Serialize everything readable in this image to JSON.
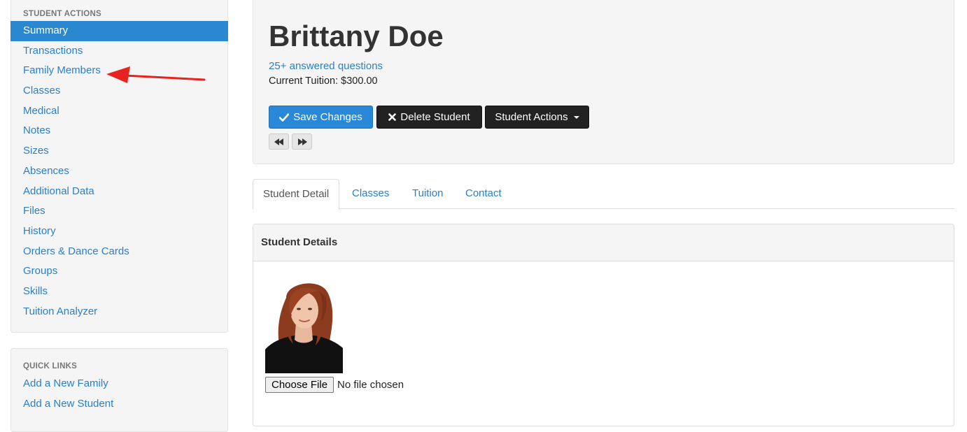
{
  "sidebar": {
    "student_actions": {
      "header": "STUDENT ACTIONS",
      "items": [
        {
          "label": "Summary",
          "active": true
        },
        {
          "label": "Transactions"
        },
        {
          "label": "Family Members"
        },
        {
          "label": "Classes"
        },
        {
          "label": "Medical"
        },
        {
          "label": "Notes"
        },
        {
          "label": "Sizes"
        },
        {
          "label": "Absences"
        },
        {
          "label": "Additional Data"
        },
        {
          "label": "Files"
        },
        {
          "label": "History"
        },
        {
          "label": "Orders & Dance Cards"
        },
        {
          "label": "Groups"
        },
        {
          "label": "Skills"
        },
        {
          "label": "Tuition Analyzer"
        }
      ]
    },
    "quick_links": {
      "header": "QUICK LINKS",
      "items": [
        {
          "label": "Add a New Family"
        },
        {
          "label": "Add a New Student"
        }
      ]
    }
  },
  "student": {
    "name": "Brittany Doe",
    "answered_link": "25+ answered questions",
    "tuition_text": "Current Tuition: $300.00"
  },
  "toolbar": {
    "save_label": "Save Changes",
    "delete_label": "Delete Student",
    "actions_label": "Student Actions"
  },
  "tabs": [
    {
      "label": "Student Detail",
      "active": true
    },
    {
      "label": "Classes"
    },
    {
      "label": "Tuition"
    },
    {
      "label": "Contact"
    }
  ],
  "details": {
    "heading": "Student Details",
    "choose_file_label": "Choose File",
    "no_file_text": "No file chosen"
  },
  "colors": {
    "link": "#2a7fc9",
    "primary": "#2a88d9",
    "dark_button": "#222222",
    "annotation_arrow": "#e8231f"
  },
  "icons": {
    "save": "check-icon",
    "delete": "close-icon",
    "actions": "caret-down-icon",
    "prev": "fast-backward-icon",
    "next": "fast-forward-icon"
  }
}
